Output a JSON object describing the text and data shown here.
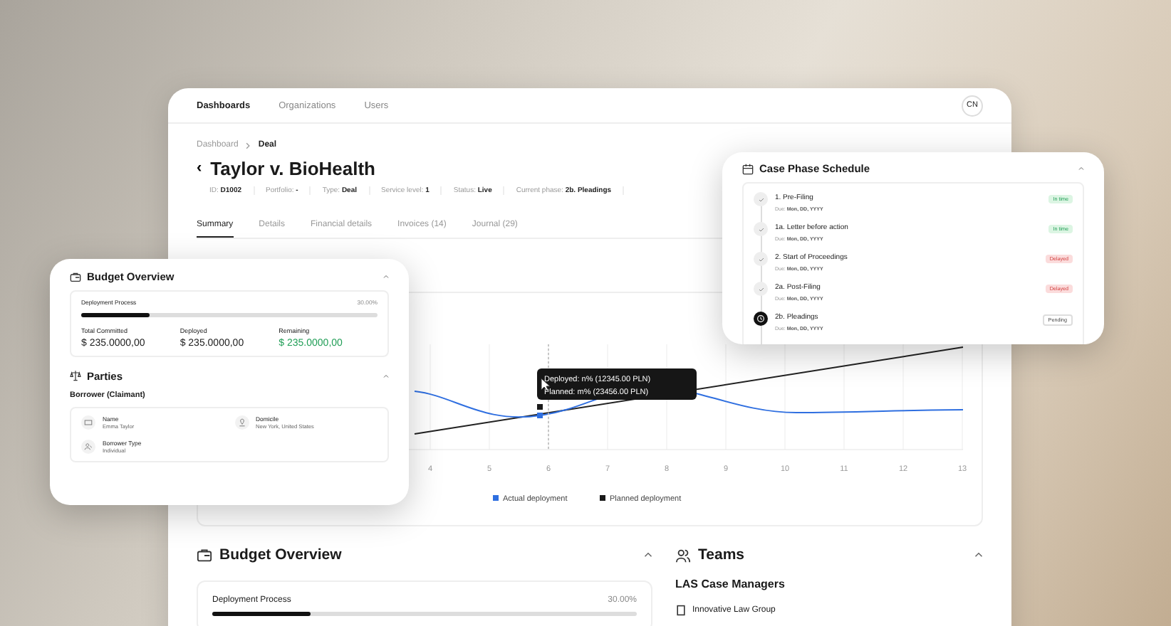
{
  "nav": {
    "items": [
      {
        "label": "Dashboards",
        "selected": true
      },
      {
        "label": "Organizations",
        "selected": false
      },
      {
        "label": "Users",
        "selected": false
      }
    ],
    "avatar": "CN"
  },
  "breadcrumb": [
    "Dashboard",
    "Deal"
  ],
  "back": "‹",
  "title": "Taylor v. BioHealth",
  "meta": [
    {
      "label": "ID:",
      "value": "D1002"
    },
    {
      "label": "Portfolio:",
      "value": "-"
    },
    {
      "label": "Type:",
      "value": "Deal"
    },
    {
      "label": "Service level:",
      "value": "1"
    },
    {
      "label": "Status:",
      "value": "Live"
    },
    {
      "label": "Current phase:",
      "value": "2b. Pleadings"
    }
  ],
  "tabs": [
    {
      "label": "Summary",
      "selected": true
    },
    {
      "label": "Details",
      "selected": false
    },
    {
      "label": "Financial details",
      "selected": false
    },
    {
      "label": "Invoices (14)",
      "selected": false
    },
    {
      "label": "Journal (29)",
      "selected": false
    }
  ],
  "chart": {
    "x_labels": [
      "4",
      "5",
      "6",
      "7",
      "8",
      "9",
      "10",
      "11",
      "12",
      "13"
    ],
    "tooltip": [
      "Deployed: n% (12345.00 PLN)",
      "Planned: m% (23456.00 PLN)"
    ],
    "legend": [
      {
        "name": "Actual deployment",
        "color": "#2f6fe0"
      },
      {
        "name": "Planned deployment",
        "color": "#1a1a1a"
      }
    ]
  },
  "budget_bottom": {
    "title": "Budget Overview",
    "progress_label": "Deployment Process",
    "progress_value": "30.00%",
    "level": 0.23
  },
  "teams": {
    "title": "Teams",
    "group": "LAS Case Managers",
    "items": [
      "Innovative Law Group"
    ]
  },
  "budget_card": {
    "title": "Budget Overview",
    "progress_label": "Deployment Process",
    "progress_value": "30.00%",
    "level": 0.23,
    "figures": [
      {
        "label": "Total Committed",
        "value": "$ 235.0000,00",
        "positive": false
      },
      {
        "label": "Deployed",
        "value": "$ 235.0000,00",
        "positive": false
      },
      {
        "label": "Remaining",
        "value": "$ 235.0000,00",
        "positive": true
      }
    ]
  },
  "parties": {
    "title": "Parties",
    "group": "Borrower (Claimant)",
    "fields": [
      {
        "kind": "name",
        "label": "Name",
        "value": "Emma Taylor"
      },
      {
        "kind": "place",
        "label": "Domicile",
        "value": "New York, United States"
      },
      {
        "kind": "type",
        "label": "Borrower Type",
        "value": "Individual"
      }
    ]
  },
  "schedule": {
    "title": "Case Phase Schedule",
    "phases": [
      {
        "name": "1. Pre-Filing",
        "due_label": "Due:",
        "due": "Mon, DD, YYYY",
        "completed": true,
        "status": "In time",
        "kind": "ontime"
      },
      {
        "name": "1a. Letter before action",
        "due_label": "Due:",
        "due": "Mon, DD, YYYY",
        "completed": true,
        "status": "In time",
        "kind": "ontime"
      },
      {
        "name": "2. Start of Proceedings",
        "due_label": "Due:",
        "due": "Mon, DD, YYYY",
        "completed": true,
        "status": "Delayed",
        "kind": "delayed"
      },
      {
        "name": "2a. Post-Filing",
        "due_label": "Due:",
        "due": "Mon, DD, YYYY",
        "completed": true,
        "status": "Delayed",
        "kind": "delayed"
      },
      {
        "name": "2b. Pleadings",
        "due_label": "Due:",
        "due": "Mon, DD, YYYY",
        "completed": false,
        "status": "Pending",
        "kind": "pending"
      }
    ]
  }
}
